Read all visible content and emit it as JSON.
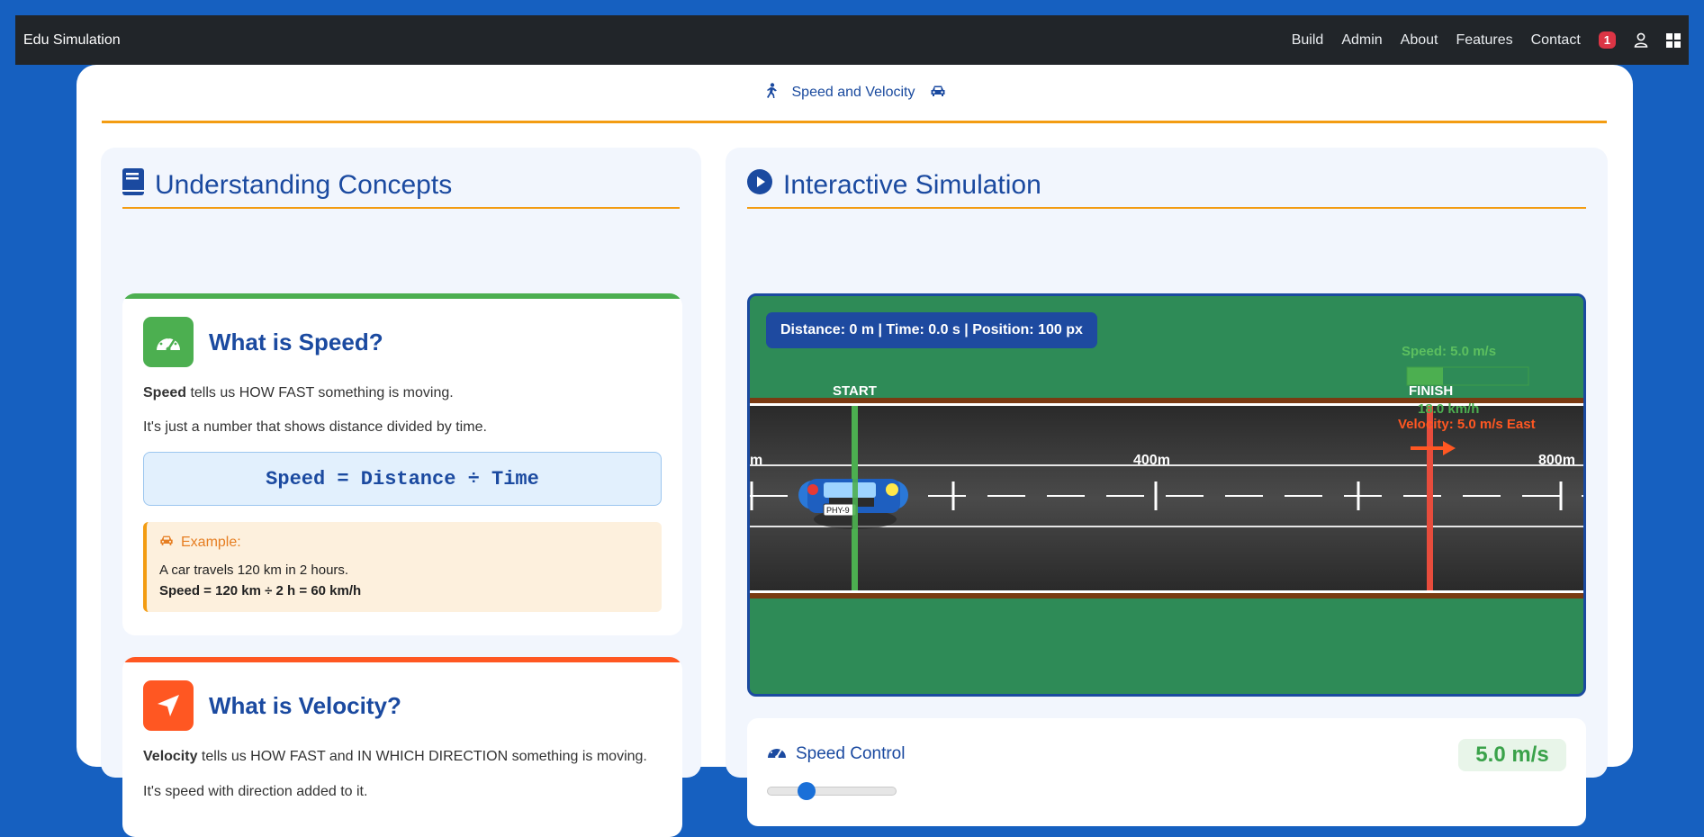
{
  "navbar": {
    "brand": "Edu Simulation",
    "links": [
      "Build",
      "Admin",
      "About",
      "Features",
      "Contact"
    ],
    "notification_count": "1"
  },
  "header": {
    "title": "Speed and Velocity"
  },
  "concepts": {
    "title": "Understanding Concepts",
    "speed": {
      "heading": "What is Speed?",
      "line1_bold": "Speed",
      "line1_rest": " tells us HOW FAST something is moving.",
      "line2": "It's just a number that shows distance divided by time.",
      "formula": "Speed = Distance ÷ Time",
      "example_title": "Example:",
      "example_line1": "A car travels 120 km in 2 hours.",
      "example_line2": "Speed = 120 km ÷ 2 h = 60 km/h"
    },
    "velocity": {
      "heading": "What is Velocity?",
      "line1_bold": "Velocity",
      "line1_rest": " tells us HOW FAST and IN WHICH DIRECTION something is moving.",
      "line2": "It's speed with direction added to it."
    }
  },
  "simulation": {
    "title": "Interactive Simulation",
    "info": "Distance: 0 m | Time: 0.0 s | Position: 100 px",
    "start_label": "START",
    "finish_label": "FINISH",
    "distance_markers": [
      "m",
      "400m",
      "800m"
    ],
    "speed_overlay": "Speed: 5.0 m/s",
    "kmh_overlay": "18.0 km/h",
    "velocity_overlay": "Velocity: 5.0 m/s East",
    "car_plate": "PHY-9"
  },
  "control": {
    "title": "Speed Control",
    "value": "5.0 m/s",
    "slider_level": 0.25
  },
  "colors": {
    "accent": "#f39c12",
    "primary": "#1b4aa0",
    "grass": "#2e8b57",
    "speed_green": "#4caf50",
    "velocity_orange": "#ff5722",
    "finish_red": "#e74c3c"
  }
}
